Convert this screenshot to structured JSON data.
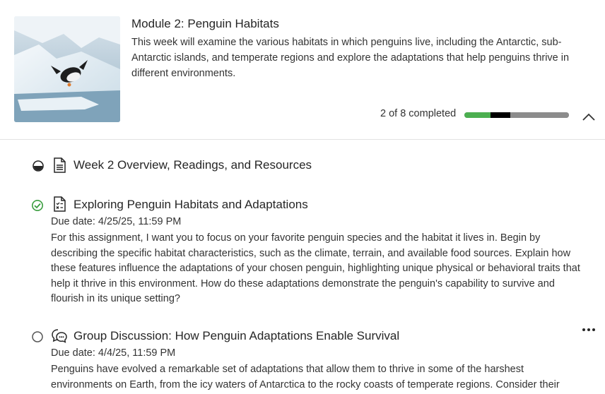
{
  "module": {
    "title": "Module 2: Penguin Habitats",
    "description": "This week will examine the various habitats in which penguins live, including the Antarctic, sub-Antarctic islands, and temperate regions and explore the adaptations that help penguins thrive in different environments.",
    "progress_text": "2 of 8 completed",
    "progress": {
      "completed": 2,
      "total": 8,
      "in_progress": 1.5
    },
    "image_icon": "penguin-photo"
  },
  "items": [
    {
      "title": "Week 2 Overview, Readings, and Resources",
      "status": "in-progress",
      "icon": "document-icon"
    },
    {
      "title": "Exploring Penguin Habitats and Adaptations",
      "status": "completed",
      "icon": "assignment-icon",
      "due": "Due date: 4/25/25, 11:59 PM",
      "description": "For this assignment, I want you to focus on your favorite penguin species and the habitat it lives in. Begin by describing the specific habitat characteristics, such as the climate, terrain, and available food sources. Explain how these features influence the adaptations of your chosen penguin, highlighting unique physical or behavioral traits that help it thrive in this environment. How do these adaptations demonstrate the penguin's capability to survive and flourish in its unique setting?"
    },
    {
      "title": "Group Discussion: How Penguin Adaptations Enable Survival",
      "status": "not-started",
      "icon": "discussion-icon",
      "due": "Due date: 4/4/25, 11:59 PM",
      "description": "Penguins have evolved a remarkable set of adaptations that allow them to thrive in some of the harshest environments on Earth, from the icy waters of Antarctica to the rocky coasts of temperate regions. Consider their"
    }
  ],
  "colors": {
    "progress_done": "#4caf50",
    "progress_current": "#000000",
    "progress_remaining": "#8c8c8c",
    "complete_check": "#3a9d3f"
  }
}
